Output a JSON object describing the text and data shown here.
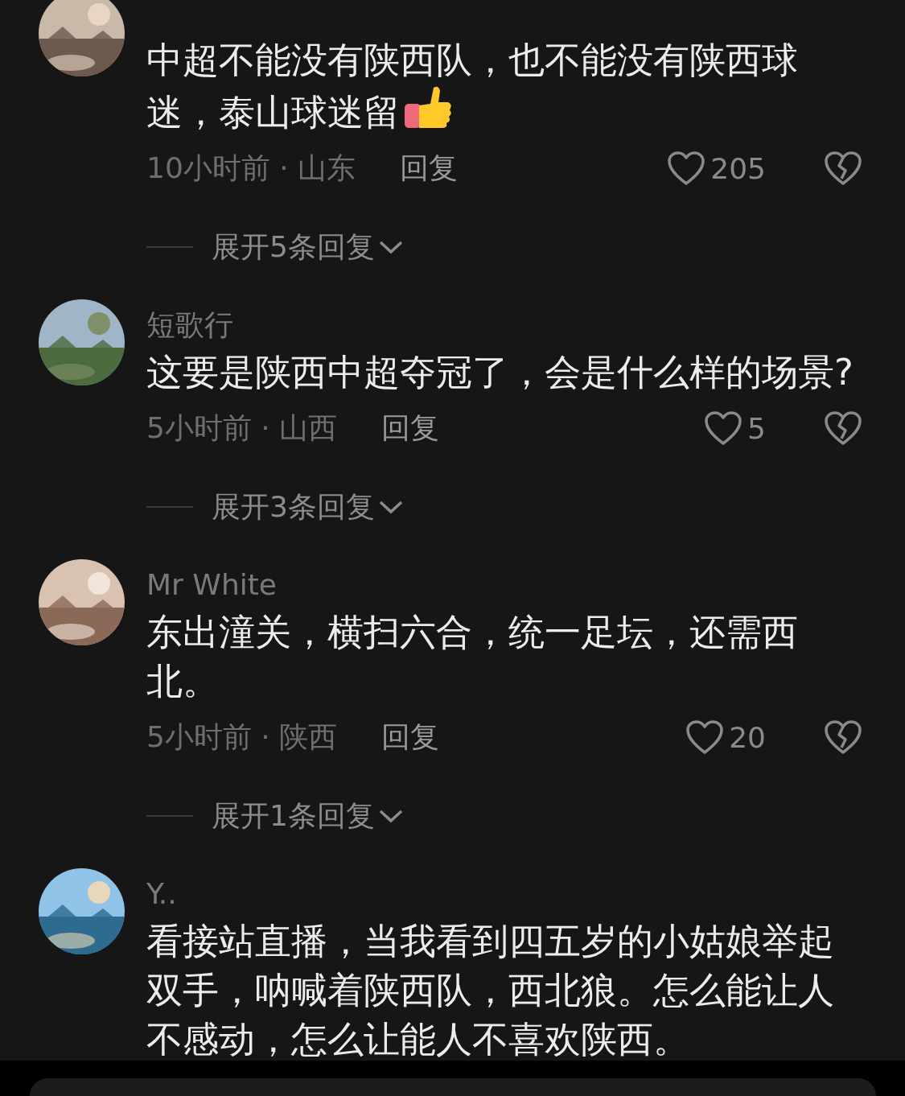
{
  "comments": [
    {
      "body": "中超不能没有陕西队，也不能没有陕西球迷，泰山球迷留",
      "trailing_icon": {
        "kind": "thumbs-up"
      },
      "time": "10小时前 · 山东",
      "reply": "回复",
      "likes": "205",
      "expand": "展开5条回复"
    },
    {
      "author": "短歌行",
      "body": "这要是陕西中超夺冠了，会是什么样的场景?",
      "time": "5小时前 · 山西",
      "reply": "回复",
      "likes": "5",
      "expand": "展开3条回复"
    },
    {
      "author": "Mr White",
      "body": "东出潼关，横扫六合，统一足坛，还需西北。",
      "time": "5小时前 · 陕西",
      "reply": "回复",
      "likes": "20",
      "expand": "展开1条回复"
    },
    {
      "author": "Y..",
      "body": "看接站直播，当我看到四五岁的小姑娘举起双手，呐喊着陕西队，西北狼。怎么能让人不感动，怎么让能人不喜欢陕西。"
    }
  ]
}
